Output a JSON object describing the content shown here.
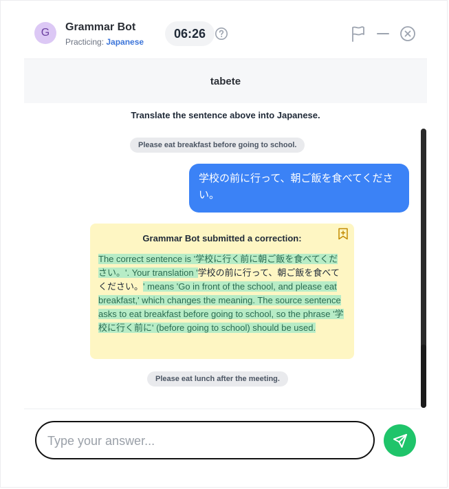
{
  "header": {
    "avatar_letter": "G",
    "bot_name": "Grammar Bot",
    "practicing_label": "Practicing:",
    "language": "Japanese",
    "timer": "06:26"
  },
  "prompt": {
    "word": "tabete"
  },
  "chat": {
    "instruction": "Translate the sentence above into Japanese.",
    "source_sentence_1": "Please eat breakfast before going to school.",
    "user_answer": "学校の前に行って、朝ご飯を食べてください。",
    "correction": {
      "title": "Grammar Bot submitted a correction:",
      "part1": "The correct sentence is '学校に行く前に朝ご飯を食べてください。'. Your translation '",
      "part2": "学校の前に行って、朝ご飯を食べてください。",
      "part3": "' means 'Go in front of the school, and please eat breakfast,' which changes the meaning. The source sentence asks to eat breakfast before going to school, so the phrase '学校に行く前に' (before going to school) should be used."
    },
    "source_sentence_2": "Please eat lunch after the meeting."
  },
  "input": {
    "placeholder": "Type your answer..."
  },
  "colors": {
    "accent_blue": "#3b82f6",
    "send_green": "#1fc46a",
    "correction_bg": "#fef6c3",
    "highlight_green": "#b7ecc6"
  },
  "icons": {
    "help": "question-circle-icon",
    "flag": "flag-icon",
    "minimize": "minus-icon",
    "close": "close-circle-icon",
    "bookmark": "bookmark-plus-icon",
    "send": "paper-plane-icon"
  }
}
